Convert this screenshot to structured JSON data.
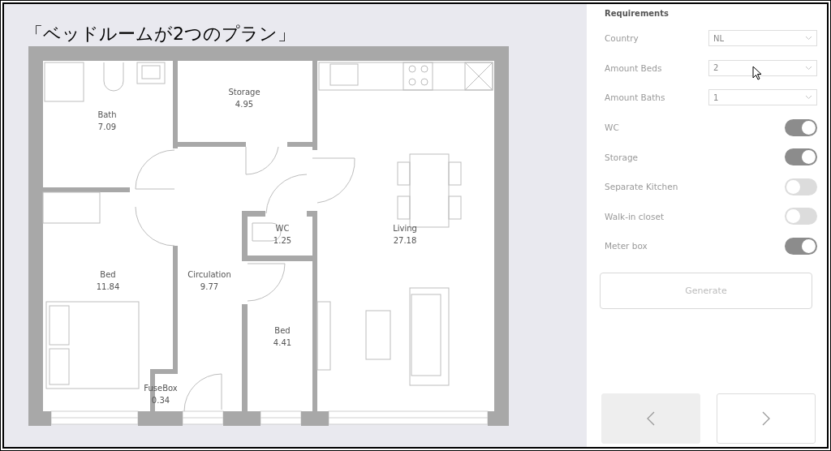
{
  "title": "「ベッドルームが2つのプラン」",
  "plan": {
    "rooms": [
      {
        "name": "Bath",
        "area": "7.09"
      },
      {
        "name": "Storage",
        "area": "4.95"
      },
      {
        "name": "WC",
        "area": "1.25"
      },
      {
        "name": "Living",
        "area": "27.18"
      },
      {
        "name": "Bed",
        "area": "11.84"
      },
      {
        "name": "Circulation",
        "area": "9.77"
      },
      {
        "name": "Bed",
        "area": "4.41"
      },
      {
        "name": "FuseBox",
        "area": "0.34"
      }
    ]
  },
  "requirements": {
    "heading": "Requirements",
    "selects": [
      {
        "label": "Country",
        "value": "NL"
      },
      {
        "label": "Amount Beds",
        "value": "2"
      },
      {
        "label": "Amount Baths",
        "value": "1"
      }
    ],
    "toggles": [
      {
        "label": "WC",
        "on": true
      },
      {
        "label": "Storage",
        "on": true
      },
      {
        "label": "Separate Kitchen",
        "on": false
      },
      {
        "label": "Walk-in closet",
        "on": false
      },
      {
        "label": "Meter box",
        "on": true
      }
    ]
  },
  "generate_button": {
    "label": "Generate",
    "disabled": true
  },
  "nav_buttons": [
    {
      "kind": "back",
      "disabled": true
    },
    {
      "kind": "next",
      "disabled": false
    }
  ]
}
